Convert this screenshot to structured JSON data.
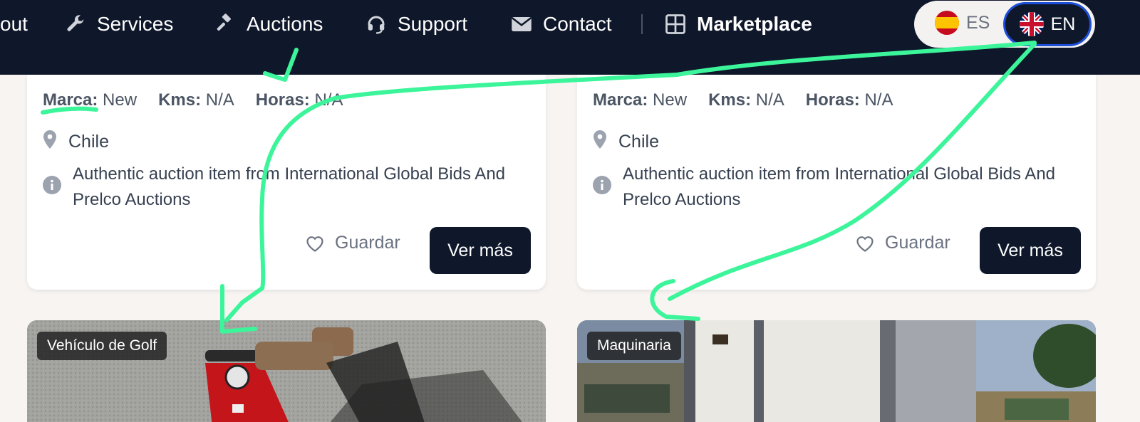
{
  "nav": {
    "items": [
      {
        "label": "out",
        "icon": "none"
      },
      {
        "label": "Services",
        "icon": "wrench-icon"
      },
      {
        "label": "Auctions",
        "icon": "gavel-icon"
      },
      {
        "label": "Support",
        "icon": "headset-icon"
      },
      {
        "label": "Contact",
        "icon": "envelope-icon"
      },
      {
        "label": "Marketplace",
        "icon": "grid-icon"
      }
    ],
    "lang": {
      "es": "ES",
      "en": "EN",
      "selected": "EN"
    }
  },
  "cards": [
    {
      "specs": [
        {
          "key": "Marca:",
          "value": "New"
        },
        {
          "key": "Kms:",
          "value": "N/A"
        },
        {
          "key": "Horas:",
          "value": "N/A"
        }
      ],
      "location": "Chile",
      "description": "Authentic auction item from International Global Bids And Prelco Auctions",
      "save_label": "Guardar",
      "more_label": "Ver más"
    },
    {
      "specs": [
        {
          "key": "Marca:",
          "value": "New"
        },
        {
          "key": "Kms:",
          "value": "N/A"
        },
        {
          "key": "Horas:",
          "value": "N/A"
        }
      ],
      "location": "Chile",
      "description": "Authentic auction item from International Global Bids And Prelco Auctions",
      "save_label": "Guardar",
      "more_label": "Ver más"
    }
  ],
  "listings": [
    {
      "category": "Vehículo de Golf"
    },
    {
      "category": "Maquinaria"
    }
  ],
  "colors": {
    "nav_bg": "#0f172a",
    "annotation": "#3cf59a",
    "focus_ring": "#1d4ed8"
  }
}
